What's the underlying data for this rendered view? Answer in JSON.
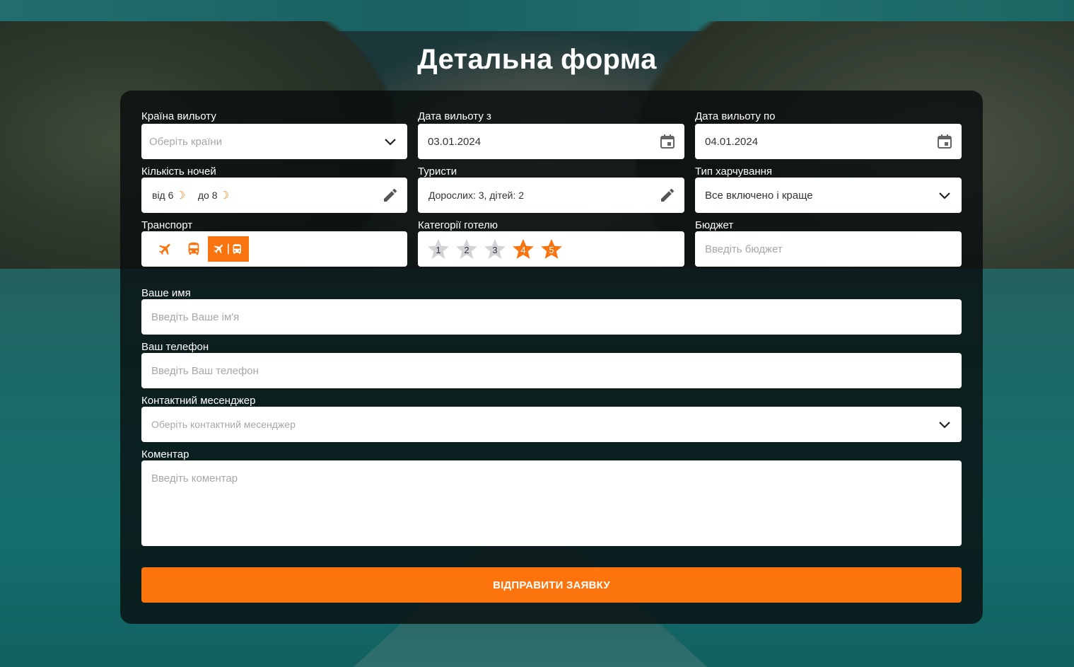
{
  "page": {
    "title": "Детальна форма"
  },
  "fields": {
    "country": {
      "label": "Країна вильоту",
      "placeholder": "Оберіть країни"
    },
    "date_from": {
      "label": "Дата вильоту з",
      "value": "03.01.2024"
    },
    "date_to": {
      "label": "Дата вильоту по",
      "value": "04.01.2024"
    },
    "nights": {
      "label": "Кількість ночей",
      "from": "від 6",
      "to": "до 8"
    },
    "tourists": {
      "label": "Туристи",
      "value": "Дорослих: 3, дітей: 2"
    },
    "meal": {
      "label": "Тип харчування",
      "value": "Все включено і краще"
    },
    "transport": {
      "label": "Транспорт",
      "options": [
        "plane-icon",
        "bus-icon",
        "plane-bus-icon"
      ],
      "selected": "plane-bus"
    },
    "hotel_category": {
      "label": "Категорії готелю",
      "stars": [
        "1",
        "2",
        "3",
        "4",
        "5"
      ],
      "selected": [
        "4",
        "5"
      ]
    },
    "budget": {
      "label": "Бюджет",
      "placeholder": "Введіть бюджет"
    },
    "name": {
      "label": "Ваше имя",
      "placeholder": "Введіть Ваше ім'я"
    },
    "phone": {
      "label": "Ваш телефон",
      "placeholder": "Введіть Ваш телефон"
    },
    "messenger": {
      "label": "Контактний месенджер",
      "placeholder": "Оберіть контактний месенджер"
    },
    "comment": {
      "label": "Коментар",
      "placeholder": "Введіть коментар"
    }
  },
  "submit": {
    "label": "ВІДПРАВИТИ ЗАЯВКУ"
  },
  "colors": {
    "accent": "#fb740e",
    "panel": "#0d1212",
    "star_inactive": "#d4d4d8"
  }
}
